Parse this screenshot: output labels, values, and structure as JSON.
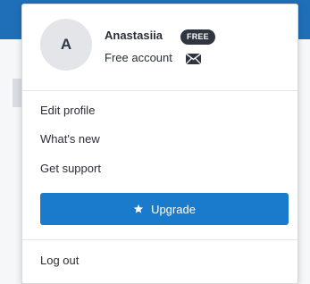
{
  "profile": {
    "avatar_initial": "A",
    "name": "Anastasiia",
    "plan_badge": "FREE",
    "account_type": "Free account",
    "mail_icon": "envelope-icon"
  },
  "menu": {
    "items": [
      {
        "label": "Edit profile"
      },
      {
        "label": "What's new"
      },
      {
        "label": "Get support"
      }
    ],
    "upgrade": {
      "label": "Upgrade",
      "icon": "star-icon"
    },
    "logout": {
      "label": "Log out"
    }
  },
  "colors": {
    "primary": "#1a7acb",
    "badge_bg": "#2f3640",
    "text": "#2a2f36",
    "avatar_bg": "#e3e5e8"
  }
}
